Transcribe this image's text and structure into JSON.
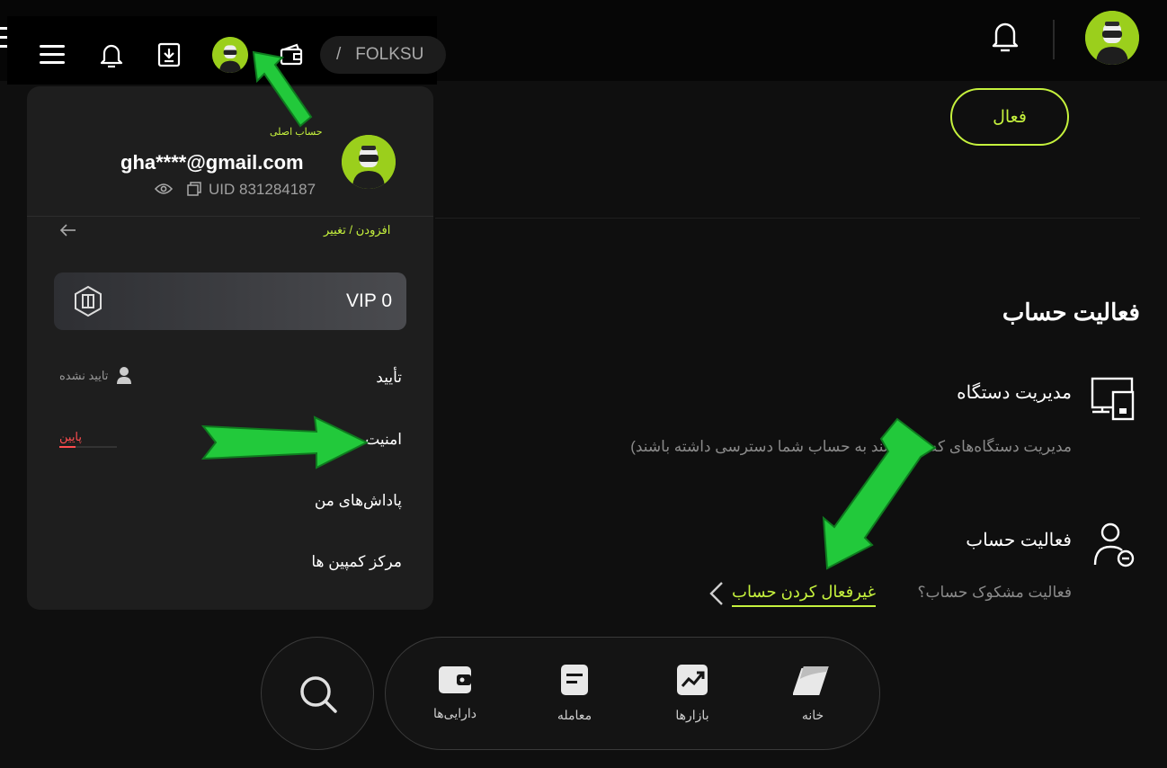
{
  "header": {
    "status_button": "فعال"
  },
  "mini_header": {
    "path_prefix": "/",
    "path_text": "FOLKSU"
  },
  "account_menu": {
    "main_account_label": "حساب اصلی",
    "email": "gha****@gmail.com",
    "uid": "UID 831284187",
    "switch_label": "افزودن / تغییر",
    "vip_level": "VIP 0",
    "items": [
      {
        "label": "تأیید",
        "status": "تایید نشده"
      },
      {
        "label": "امنیت",
        "status": "پایین"
      },
      {
        "label": "پاداش‌های من"
      },
      {
        "label": "مرکز کمپین ها"
      }
    ]
  },
  "section": {
    "title": "فعالیت حساب",
    "device_title": "مدیریت دستگاه",
    "device_desc": "مدیریت دستگاه‌های که می‌توانند به حساب شما دسترسی داشته باشند)",
    "activity_title": "فعالیت حساب",
    "suspicious_text": "فعالیت مشکوک حساب؟",
    "deactivate_link": "غیرفعال کردن حساب"
  },
  "bottom_nav": {
    "items": [
      {
        "label": "دارایی‌ها",
        "icon": "wallet-icon"
      },
      {
        "label": "معامله",
        "icon": "trade-icon"
      },
      {
        "label": "بازارها",
        "icon": "chart-icon"
      },
      {
        "label": "خانه",
        "icon": "home-icon"
      }
    ]
  },
  "colors": {
    "accent": "#c5f13d",
    "arrow": "#22c93b",
    "warning": "#ff4d4f"
  }
}
